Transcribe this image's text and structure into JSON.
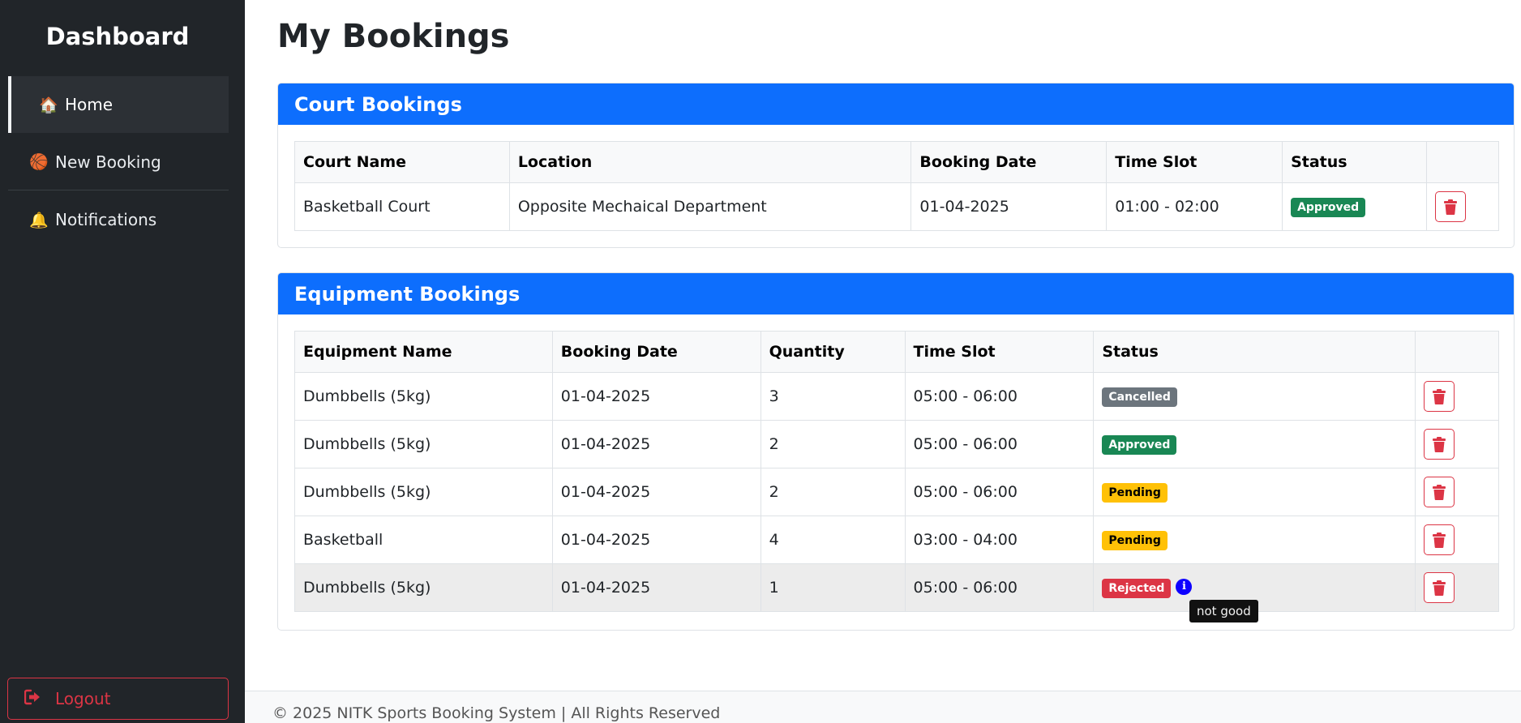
{
  "sidebar": {
    "title": "Dashboard",
    "items": [
      {
        "label": "Home",
        "icon": "house-icon",
        "glyph": "🏠"
      },
      {
        "label": "New Booking",
        "icon": "basketball-icon",
        "glyph": "🏀"
      },
      {
        "label": "Notifications",
        "icon": "bell-icon",
        "glyph": "🔔"
      }
    ],
    "logout_label": "Logout"
  },
  "page": {
    "title": "My Bookings"
  },
  "court": {
    "header": "Court Bookings",
    "columns": [
      "Court Name",
      "Location",
      "Booking Date",
      "Time Slot",
      "Status"
    ],
    "rows": [
      {
        "name": "Basketball Court",
        "location": "Opposite Mechaical Department",
        "date": "01-04-2025",
        "slot": "01:00 - 02:00",
        "status": "Approved"
      }
    ]
  },
  "equipment": {
    "header": "Equipment Bookings",
    "columns": [
      "Equipment Name",
      "Booking Date",
      "Quantity",
      "Time Slot",
      "Status"
    ],
    "rows": [
      {
        "name": "Dumbbells (5kg)",
        "date": "01-04-2025",
        "qty": "3",
        "slot": "05:00 - 06:00",
        "status": "Cancelled"
      },
      {
        "name": "Dumbbells (5kg)",
        "date": "01-04-2025",
        "qty": "2",
        "slot": "05:00 - 06:00",
        "status": "Approved"
      },
      {
        "name": "Dumbbells (5kg)",
        "date": "01-04-2025",
        "qty": "2",
        "slot": "05:00 - 06:00",
        "status": "Pending"
      },
      {
        "name": "Basketball",
        "date": "01-04-2025",
        "qty": "4",
        "slot": "03:00 - 04:00",
        "status": "Pending"
      },
      {
        "name": "Dumbbells (5kg)",
        "date": "01-04-2025",
        "qty": "1",
        "slot": "05:00 - 06:00",
        "status": "Rejected"
      }
    ],
    "tooltip": "not good",
    "info_glyph": "i"
  },
  "footer": {
    "text": "© 2025 NITK Sports Booking System | All Rights Reserved"
  },
  "colors": {
    "sidebar_bg": "#212529",
    "primary": "#0d6efd",
    "approved": "#198754",
    "cancelled": "#6c757d",
    "pending": "#ffc107",
    "rejected": "#dc3545"
  }
}
